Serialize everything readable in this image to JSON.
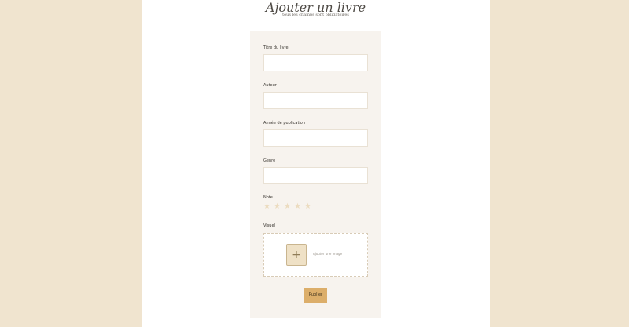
{
  "header": {
    "title": "Ajouter un livre",
    "subtitle": "tous les champs sont obligatoires"
  },
  "form": {
    "fields": [
      {
        "label": "Titre du livre",
        "value": ""
      },
      {
        "label": "Auteur",
        "value": ""
      },
      {
        "label": "Année de publication",
        "value": ""
      },
      {
        "label": "Genre",
        "value": ""
      }
    ],
    "rating": {
      "label": "Note",
      "stars": 5,
      "value": 0,
      "star_glyph": "★",
      "empty_color": "#ecdcc0"
    },
    "cover": {
      "label": "Visuel",
      "add_glyph": "+",
      "hint": "Ajouter une image"
    },
    "submit_label": "Publier"
  },
  "colors": {
    "background": "#f0e4cf",
    "card": "#f7f3ee",
    "accent": "#dcae6a"
  }
}
